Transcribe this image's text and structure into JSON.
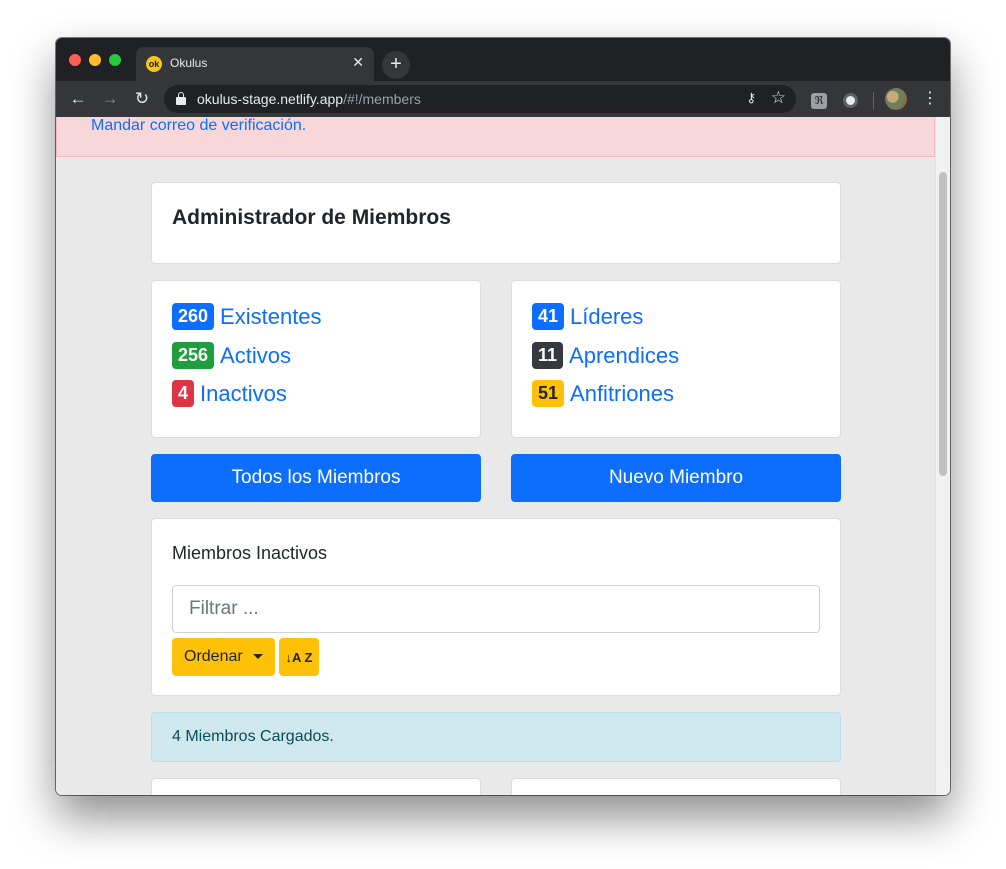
{
  "browser": {
    "tab_title": "Okulus",
    "favicon_text": "ok",
    "url_host": "okulus-stage.netlify.app",
    "url_path": "/#!/members"
  },
  "alert_verify": {
    "link_text": "Mandar correo de verificación."
  },
  "page": {
    "title": "Administrador de Miembros"
  },
  "stats_left": [
    {
      "count": "260",
      "label": "Existentes",
      "color": "#0d6efd"
    },
    {
      "count": "256",
      "label": "Activos",
      "color": "#1e9e3e"
    },
    {
      "count": "4",
      "label": "Inactivos",
      "color": "#dc3545"
    }
  ],
  "stats_right": [
    {
      "count": "41",
      "label": "Líderes",
      "color": "#0d6efd"
    },
    {
      "count": "11",
      "label": "Aprendices",
      "color": "#343a40"
    },
    {
      "count": "51",
      "label": "Anfitriones",
      "color": "#ffc107"
    }
  ],
  "buttons": {
    "all_members": "Todos los Miembros",
    "new_member": "Nuevo Miembro"
  },
  "filter": {
    "section_title": "Miembros Inactivos",
    "placeholder": "Filtrar ...",
    "order_label": "Ordenar",
    "sort_label": "↓A Z"
  },
  "status": {
    "loaded_text": "4 Miembros Cargados."
  },
  "colors": {
    "primary": "#0d6efd",
    "warning": "#ffc107",
    "alert_danger_bg": "#f8d7da",
    "alert_info_bg": "#cfe8ee"
  }
}
